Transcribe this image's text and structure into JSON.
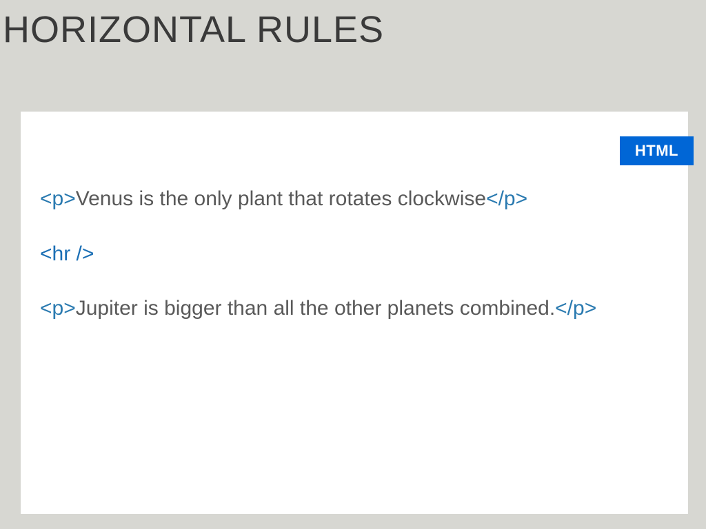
{
  "title": "HORIZONTAL RULES",
  "badge": "HTML",
  "code": {
    "line1": {
      "open": "<p>",
      "text": "Venus is the only plant that rotates clockwise",
      "close": "</p>"
    },
    "line2": {
      "tag": "<hr />"
    },
    "line3": {
      "open": "<p>",
      "text": "Jupiter is bigger than all the other planets combined.",
      "close": "</p>"
    }
  }
}
